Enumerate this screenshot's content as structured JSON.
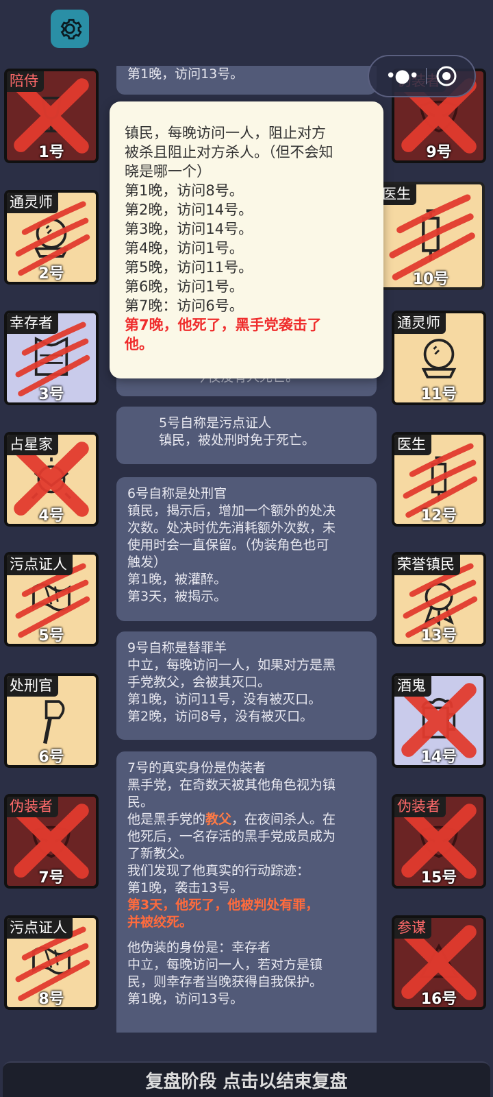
{
  "top": {
    "settings_icon": "gear-icon"
  },
  "capsule": {
    "more_icon": "more-dots-icon",
    "close_icon": "target-icon"
  },
  "colors": {
    "background": "#2b2f45",
    "card": "#525a78",
    "popup": "#fbf8e7",
    "beige_tile": "#f6d9a2",
    "dark_red_tile": "#6b2424",
    "lavender_tile": "#c9cbeb",
    "mark_red": "#e23b2e",
    "highlight_red": "#ef2d2d",
    "gear_bg": "#2a8fa6"
  },
  "players_left": [
    {
      "role": "陪侍",
      "number": "1号",
      "status": "x",
      "tile": "dark",
      "icon": "wine-glass-icon",
      "label_red": true
    },
    {
      "role": "通灵师",
      "number": "2号",
      "status": "claw",
      "tile": "beige",
      "icon": "crystal-ball-icon",
      "label_red": false
    },
    {
      "role": "幸存者",
      "number": "3号",
      "status": "claw",
      "tile": "lavender",
      "icon": "vest-icon",
      "label_red": false
    },
    {
      "role": "占星家",
      "number": "4号",
      "status": "x",
      "tile": "beige",
      "icon": "astrolabe-icon",
      "label_red": false
    },
    {
      "role": "污点证人",
      "number": "5号",
      "status": "claw",
      "tile": "beige",
      "icon": "scroll-icon",
      "label_red": false
    },
    {
      "role": "处刑官",
      "number": "6号",
      "status": "none",
      "tile": "beige",
      "icon": "axe-icon",
      "label_red": false
    },
    {
      "role": "伪装者",
      "number": "7号",
      "status": "x",
      "tile": "dark",
      "icon": "mask-icon",
      "label_red": true
    },
    {
      "role": "污点证人",
      "number": "8号",
      "status": "claw",
      "tile": "beige",
      "icon": "scroll-icon",
      "label_red": false
    }
  ],
  "players_right": [
    {
      "role": "伪装者",
      "number": "9号",
      "status": "x",
      "tile": "dark",
      "icon": "mask-icon",
      "label_red": true
    },
    {
      "role": "医生",
      "number": "10号",
      "status": "claw",
      "tile": "beige",
      "icon": "syringe-icon",
      "label_red": false
    },
    {
      "role": "通灵师",
      "number": "11号",
      "status": "none",
      "tile": "beige",
      "icon": "crystal-ball-icon",
      "label_red": false
    },
    {
      "role": "医生",
      "number": "12号",
      "status": "claw",
      "tile": "beige",
      "icon": "syringe-icon",
      "label_red": false
    },
    {
      "role": "荣誉镇民",
      "number": "13号",
      "status": "claw",
      "tile": "beige",
      "icon": "medal-icon",
      "label_red": false
    },
    {
      "role": "酒鬼",
      "number": "14号",
      "status": "x",
      "tile": "lavender",
      "icon": "beer-mug-icon",
      "label_red": false
    },
    {
      "role": "伪装者",
      "number": "15号",
      "status": "x",
      "tile": "dark",
      "icon": "mask-icon",
      "label_red": true
    },
    {
      "role": "参谋",
      "number": "16号",
      "status": "x",
      "tile": "dark",
      "icon": "triangle-icon",
      "label_red": true
    }
  ],
  "log": {
    "card0": {
      "l1": "第1晚，访问13号。"
    },
    "card_hidden": {
      "l1": "今夜没有人死亡。"
    },
    "card5": {
      "l1": "5号自称是污点证人",
      "l2": "镇民，被处刑时免于死亡。"
    },
    "card6": {
      "l1": "6号自称是处刑官",
      "l2": "镇民，揭示后，增加一个额外的处决",
      "l3": "次数。处决时优先消耗额外次数，未",
      "l4": "使用时会一直保留。（伪装角色也可",
      "l5": "触发）",
      "l6": "第1晚，被灌醉。",
      "l7": "第3天，被揭示。"
    },
    "card9": {
      "l1": "9号自称是替罪羊",
      "l2": "中立，每晚访问一人，如果对方是黑",
      "l3": "手党教父，会被其灭口。",
      "l4": "第1晚，访问11号，没有被灭口。",
      "l5": "第2晚，访问8号，没有被灭口。"
    },
    "card7": {
      "l1": "7号的真实身份是伪装者",
      "l2": "黑手党，在奇数天被其他角色视为镇",
      "l3": "民。",
      "l4a": "他是黑手党的",
      "l4b": "教父",
      "l4c": "，在夜间杀人。在",
      "l5": "他死后，一名存活的黑手党成员成为",
      "l6": "了新教父。",
      "l7": "我们发现了他真实的行动踪迹：",
      "l8": "第1晚，袭击13号。",
      "l9": "第3天，他死了，他被判处有罪，",
      "l10": "并被绞死。",
      "l11": "他伪装的身份是：幸存者",
      "l12": "中立，每晚访问一人，若对方是镇",
      "l13": "民，则幸存者当晚获得自我保护。",
      "l14": "第1晚，访问13号。"
    }
  },
  "popup": {
    "l1": "镇民，每晚访问一人，阻止对方",
    "l2": "被杀且阻止对方杀人。（但不会知",
    "l3": "晓是哪一个）",
    "l4": "第1晚，访问8号。",
    "l5": "第2晚，访问14号。",
    "l6": "第3晚，访问14号。",
    "l7": "第4晚，访问1号。",
    "l8": "第5晚，访问11号。",
    "l9": "第6晚，访问1号。",
    "l10": "第7晚：访问6号。",
    "l11": "第7晚，他死了，黑手党袭击了",
    "l12": "他。"
  },
  "bottom": {
    "label": "复盘阶段 点击以结束复盘"
  }
}
